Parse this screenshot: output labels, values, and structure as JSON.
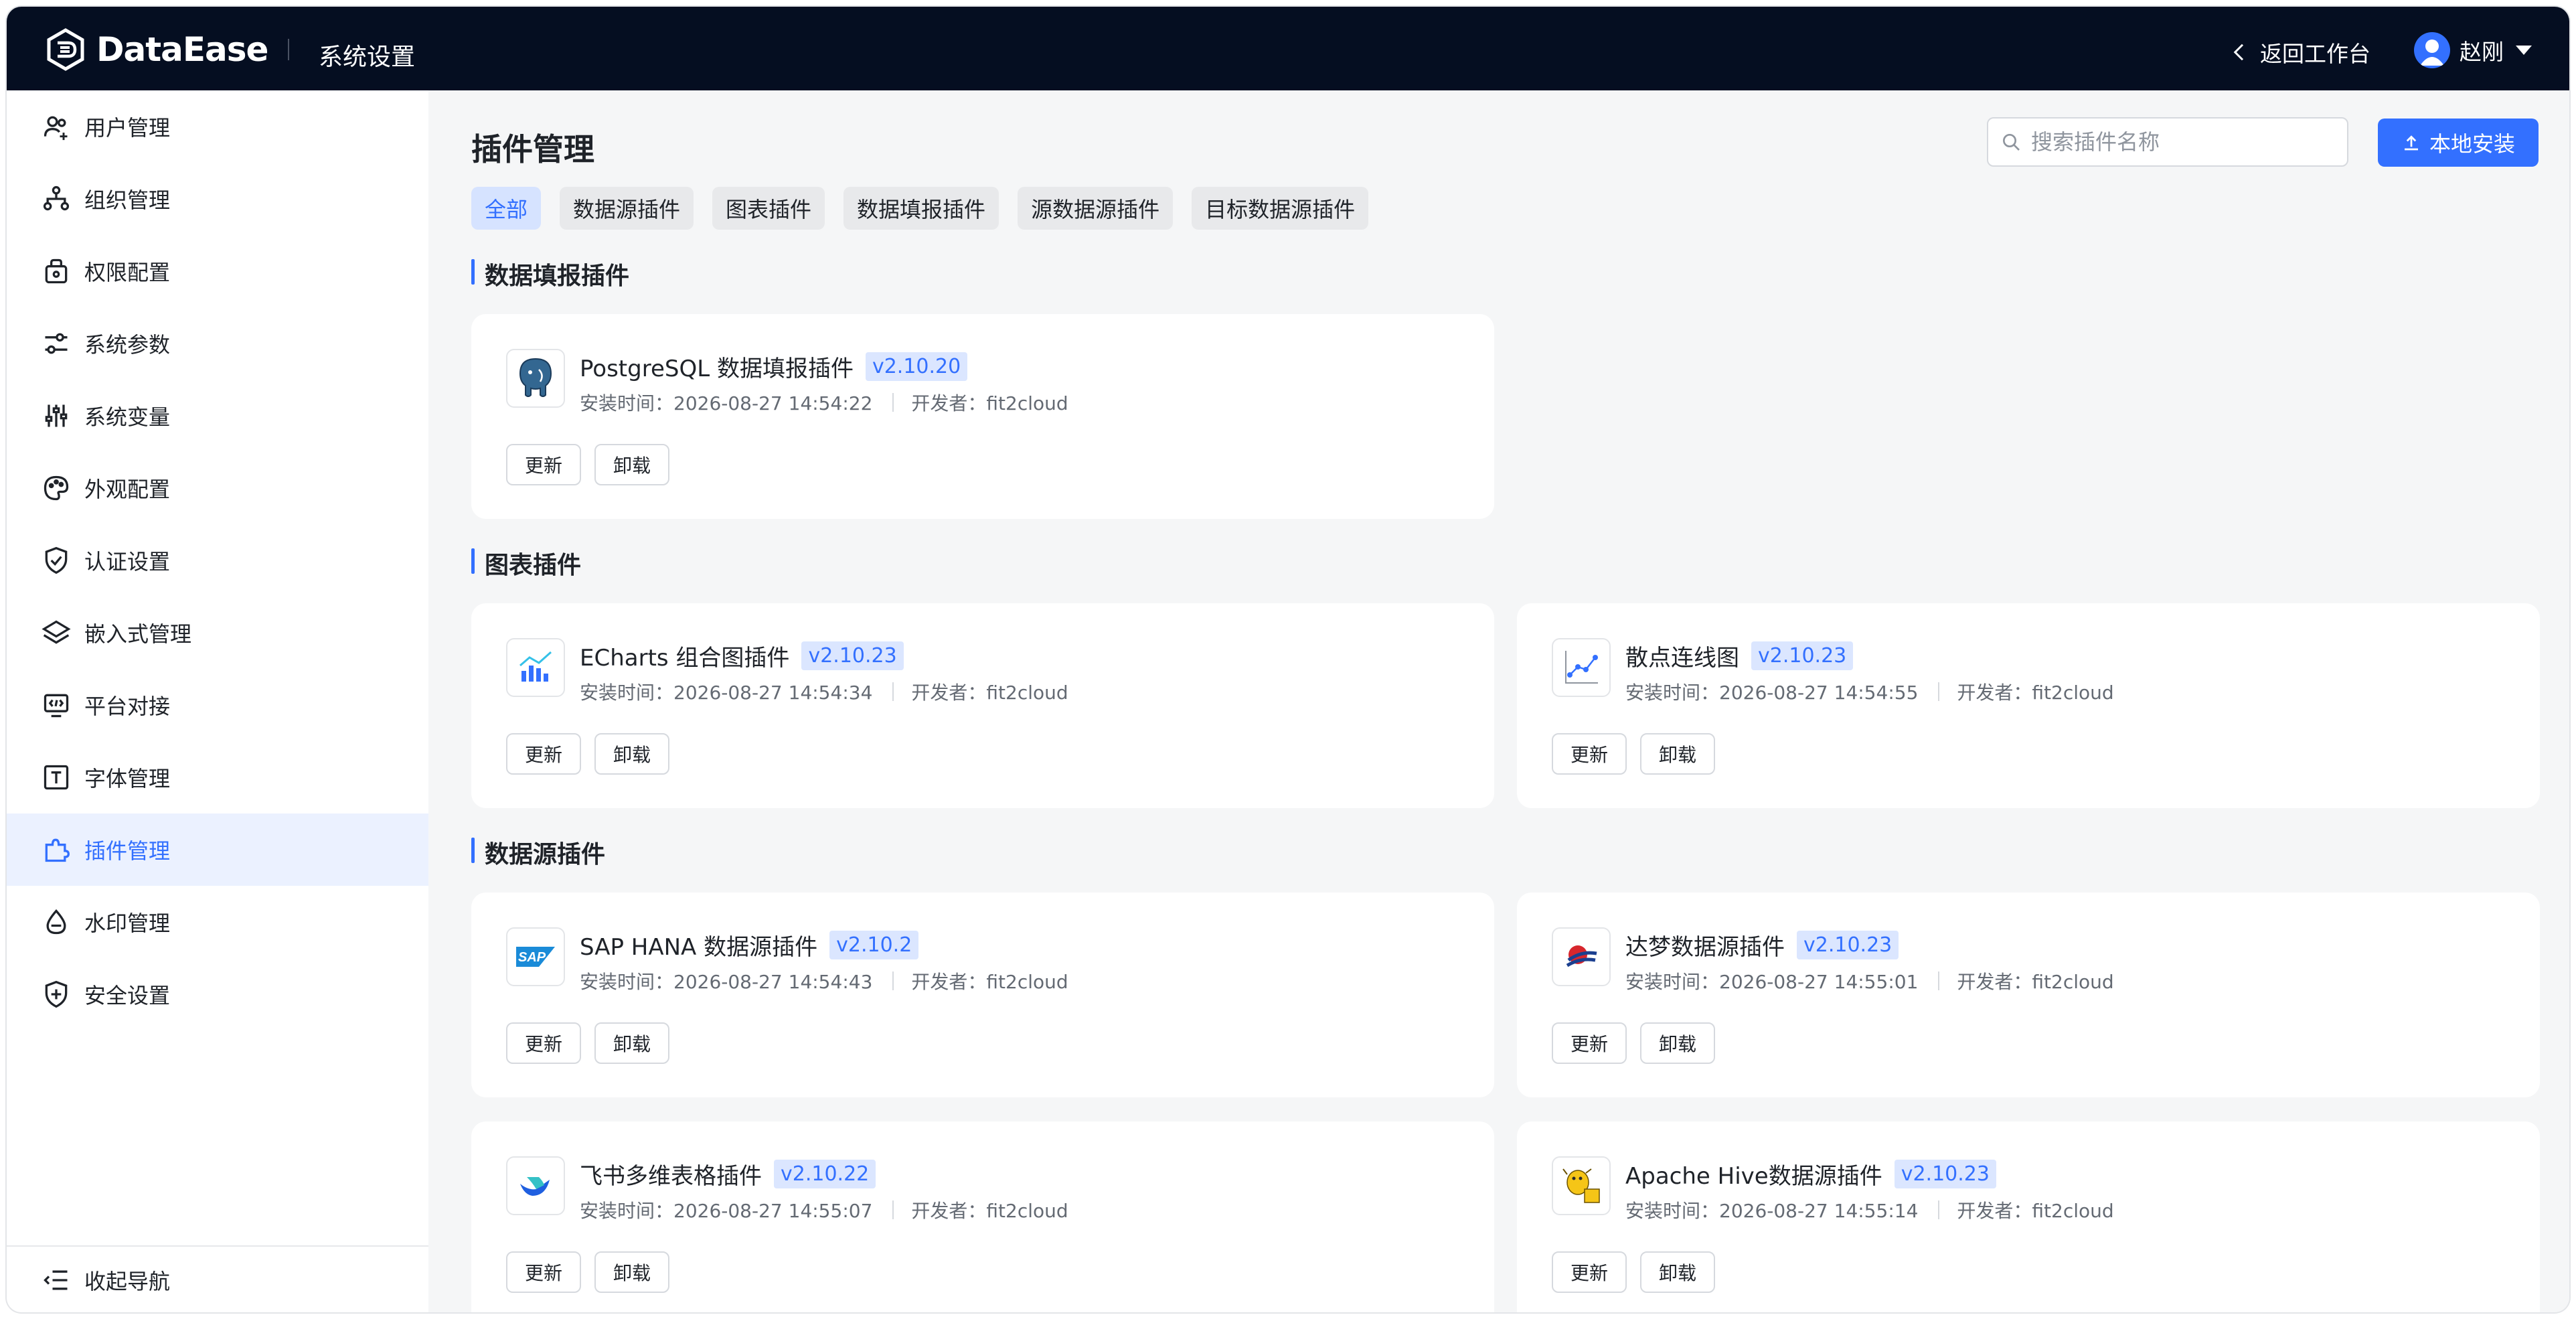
{
  "app": {
    "brand": "DataEase",
    "section_title": "系统设置",
    "back_label": "返回工作台",
    "user_name": "赵刚"
  },
  "sidebar": {
    "items": [
      {
        "label": "用户管理",
        "icon": "users-icon"
      },
      {
        "label": "组织管理",
        "icon": "org-tree-icon"
      },
      {
        "label": "权限配置",
        "icon": "lock-icon"
      },
      {
        "label": "系统参数",
        "icon": "sliders-icon"
      },
      {
        "label": "系统变量",
        "icon": "variable-sliders-icon"
      },
      {
        "label": "外观配置",
        "icon": "palette-icon"
      },
      {
        "label": "认证设置",
        "icon": "shield-check-icon"
      },
      {
        "label": "嵌入式管理",
        "icon": "layers-icon"
      },
      {
        "label": "平台对接",
        "icon": "monitor-code-icon"
      },
      {
        "label": "字体管理",
        "icon": "font-icon"
      },
      {
        "label": "插件管理",
        "icon": "puzzle-icon",
        "active": true
      },
      {
        "label": "水印管理",
        "icon": "drop-icon"
      },
      {
        "label": "安全设置",
        "icon": "shield-plus-icon"
      }
    ],
    "collapse_label": "收起导航"
  },
  "main": {
    "title": "插件管理",
    "search_placeholder": "搜索插件名称",
    "install_label": "本地安装",
    "filters": [
      "全部",
      "数据源插件",
      "图表插件",
      "数据填报插件",
      "源数据源插件",
      "目标数据源插件"
    ],
    "active_filter": "全部",
    "sections": [
      {
        "title": "数据填报插件",
        "plugins": [
          {
            "name": "PostgreSQL 数据填报插件",
            "version": "v2.10.20",
            "install_time": "安装时间：2026-08-27 14:54:22",
            "developer": "开发者：fit2cloud",
            "icon": "postgresql-icon"
          }
        ]
      },
      {
        "title": "图表插件",
        "plugins": [
          {
            "name": "ECharts 组合图插件",
            "version": "v2.10.23",
            "install_time": "安装时间：2026-08-27 14:54:34",
            "developer": "开发者：fit2cloud",
            "icon": "echarts-combo-icon"
          },
          {
            "name": "散点连线图",
            "version": "v2.10.23",
            "install_time": "安装时间：2026-08-27 14:54:55",
            "developer": "开发者：fit2cloud",
            "icon": "scatter-line-icon"
          }
        ]
      },
      {
        "title": "数据源插件",
        "plugins": [
          {
            "name": "SAP HANA 数据源插件",
            "version": "v2.10.2",
            "install_time": "安装时间：2026-08-27 14:54:43",
            "developer": "开发者：fit2cloud",
            "icon": "sap-icon"
          },
          {
            "name": "达梦数据源插件",
            "version": "v2.10.23",
            "install_time": "安装时间：2026-08-27 14:55:01",
            "developer": "开发者：fit2cloud",
            "icon": "dameng-icon"
          },
          {
            "name": "飞书多维表格插件",
            "version": "v2.10.22",
            "install_time": "安装时间：2026-08-27 14:55:07",
            "developer": "开发者：fit2cloud",
            "icon": "feishu-icon"
          },
          {
            "name": "Apache Hive数据源插件",
            "version": "v2.10.23",
            "install_time": "安装时间：2026-08-27 14:55:14",
            "developer": "开发者：fit2cloud",
            "icon": "hive-icon"
          }
        ]
      }
    ],
    "update_label": "更新",
    "uninstall_label": "卸载"
  },
  "colors": {
    "topbar": "#050e21",
    "accent": "#3370ff",
    "active_bg": "#ebf1ff",
    "page_bg": "#f5f6f7"
  }
}
